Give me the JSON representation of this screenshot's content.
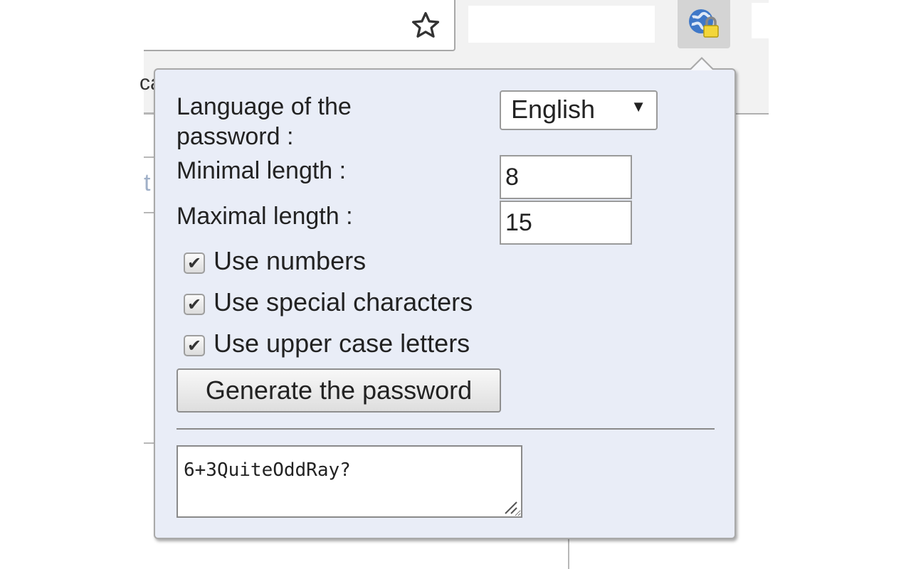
{
  "browser": {
    "bookmark_icon": "star-outline-icon",
    "extension_icon": "globe-lock-icon",
    "page_edge_text_1": "ca",
    "page_edge_text_2": "t"
  },
  "popup": {
    "language": {
      "label": "Language of the password :",
      "label_line1": "Language of the",
      "label_line2": "password :",
      "selected": "English",
      "caret": "▼"
    },
    "min_length": {
      "label": "Minimal length :",
      "value": "8"
    },
    "max_length": {
      "label": "Maximal length :",
      "value": "15"
    },
    "options": [
      {
        "label": "Use numbers",
        "checked": true
      },
      {
        "label": "Use special characters",
        "checked": true
      },
      {
        "label": "Use upper case letters",
        "checked": true
      }
    ],
    "check_glyph": "✔",
    "generate_button": "Generate the password",
    "output": "6+3QuiteOddRay?"
  }
}
